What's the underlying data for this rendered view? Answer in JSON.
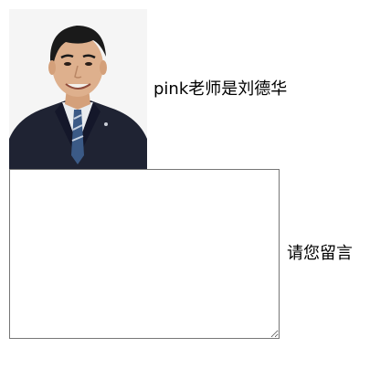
{
  "profile": {
    "caption": "pink老师是刘德华",
    "photo_icon": "portrait-photo"
  },
  "comment": {
    "value": "",
    "prompt": "请您留言"
  },
  "colors": {
    "background": "#ffffff",
    "text": "#000000",
    "textarea_border": "#767676"
  }
}
